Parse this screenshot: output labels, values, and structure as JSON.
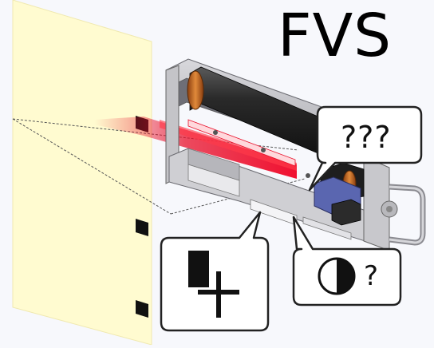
{
  "title": "FVS",
  "callouts": {
    "unknown": {
      "text": "???"
    },
    "contrast": {
      "text": "?",
      "icon": "half-filled-circle-icon"
    },
    "add_mark": {
      "icon": "add-mark-icon"
    }
  },
  "colors": {
    "sheet": "#fffbd0",
    "laser": "#e8102a",
    "roller": "#2b2b2b",
    "frame": "#b9b9bd",
    "accent_orange": "#cc6a1c",
    "accent_blue": "#5a66b0"
  }
}
